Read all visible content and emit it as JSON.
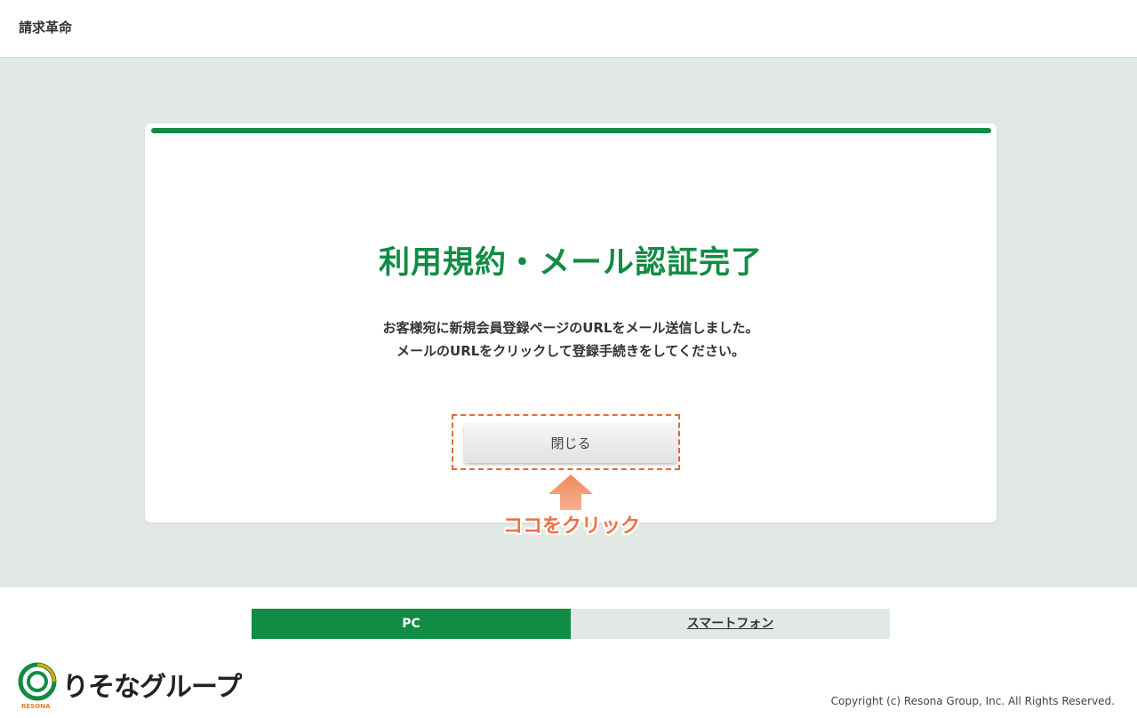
{
  "header": {
    "app_title": "請求革命"
  },
  "card": {
    "title": "利用規約・メール認証完了",
    "message_lines": [
      "お客様宛に新規会員登録ページのURLをメール送信しました。",
      "メールのURLをクリックして登録手続きをしてください。"
    ],
    "close_label": "閉じる"
  },
  "annotation": {
    "callout": "ココをクリック",
    "accent_color": "#ef7046"
  },
  "device_toggle": {
    "pc_label": "PC",
    "smartphone_label": "スマートフォン"
  },
  "footer": {
    "logo_text": "りそなグループ",
    "logo_sub": "RESONA",
    "copyright": "Copyright (c) Resona Group, Inc. All Rights Reserved."
  },
  "colors": {
    "brand_green": "#118c44",
    "background": "#e2e8e3"
  }
}
